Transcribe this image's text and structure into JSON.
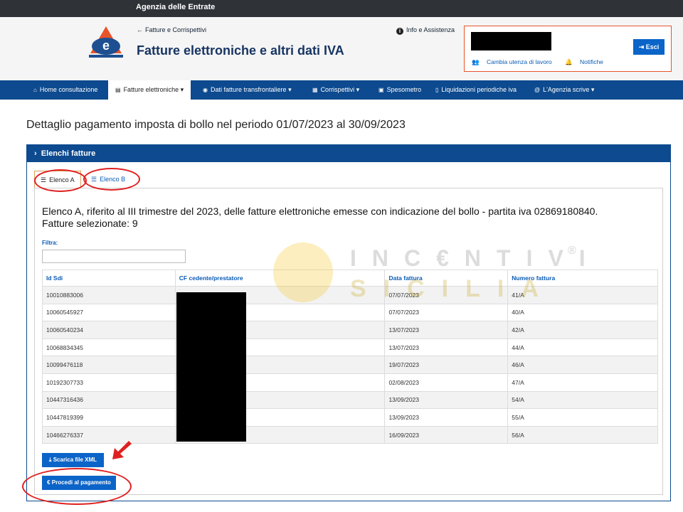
{
  "topbar": {
    "title": "Agenzia delle Entrate"
  },
  "header": {
    "back_link": "Fatture e Corrispettivi",
    "app_title": "Fatture elettroniche e altri dati IVA",
    "info_link": "Info e Assistenza",
    "info_icon": "i",
    "user": {
      "change_user": "Cambia utenza di lavoro",
      "notifications": "Notifiche",
      "logout": "Esci"
    }
  },
  "nav": {
    "items": [
      {
        "label": "Home consultazione",
        "icon": "home-icon",
        "glyph": "⌂"
      },
      {
        "label": "Fatture elettroniche",
        "icon": "document-icon",
        "glyph": "▤",
        "dropdown": "▾"
      },
      {
        "label": "Dati fatture transfrontaliere",
        "icon": "globe-icon",
        "glyph": "◉",
        "dropdown": "▾"
      },
      {
        "label": "Corrispettivi",
        "icon": "calculator-icon",
        "glyph": "▦",
        "dropdown": "▾"
      },
      {
        "label": "Spesometro",
        "icon": "bag-icon",
        "glyph": "▣"
      },
      {
        "label": "Liquidazioni periodiche iva",
        "icon": "file-icon",
        "glyph": "▯"
      },
      {
        "label": "L'Agenzia scrive",
        "icon": "at-icon",
        "glyph": "@",
        "dropdown": "▾"
      }
    ]
  },
  "page": {
    "title": "Dettaglio pagamento imposta di bollo nel periodo 01/07/2023 al 30/09/2023"
  },
  "panel": {
    "header": "Elenchi fatture",
    "header_icon": "›",
    "tabs": [
      {
        "label": "Elenco A",
        "glyph": "☰",
        "active": true
      },
      {
        "label": "Elenco B",
        "glyph": "☰",
        "active": false
      }
    ],
    "heading_line1": "Elenco A, riferito al III trimestre del 2023, delle fatture elettroniche emesse con indicazione del bollo - partita iva 02869180840.",
    "heading_line2": "Fatture selezionate: 9",
    "filter_label": "Filtra:",
    "filter_value": ""
  },
  "table": {
    "columns": [
      "Id Sdi",
      "CF cedente/prestatore",
      "Data fattura",
      "Numero fattura"
    ],
    "rows": [
      {
        "id_sdi": "10010883006",
        "cf": "",
        "data": "07/07/2023",
        "numero": "41/A"
      },
      {
        "id_sdi": "10060545927",
        "cf": "",
        "data": "07/07/2023",
        "numero": "40/A"
      },
      {
        "id_sdi": "10060540234",
        "cf": "",
        "data": "13/07/2023",
        "numero": "42/A"
      },
      {
        "id_sdi": "10068834345",
        "cf": "",
        "data": "13/07/2023",
        "numero": "44/A"
      },
      {
        "id_sdi": "10099476118",
        "cf": "",
        "data": "19/07/2023",
        "numero": "46/A"
      },
      {
        "id_sdi": "10192307733",
        "cf": "",
        "data": "02/08/2023",
        "numero": "47/A"
      },
      {
        "id_sdi": "10447316436",
        "cf": "",
        "data": "13/09/2023",
        "numero": "54/A"
      },
      {
        "id_sdi": "10447819399",
        "cf": "",
        "data": "13/09/2023",
        "numero": "55/A"
      },
      {
        "id_sdi": "10466276337",
        "cf": "",
        "data": "16/09/2023",
        "numero": "56/A"
      }
    ]
  },
  "buttons": {
    "download_xml": "Scarica file XML",
    "download_glyph": "⤓",
    "pay": "Procedi al pagamento",
    "pay_glyph": "€"
  },
  "watermark": {
    "line1": "INC€NTIVI",
    "line2": "SICILIA",
    "registered": "®"
  },
  "colors": {
    "nav": "#0d4a8f",
    "button": "#0b64c8",
    "accent_border": "#e8542a",
    "annotation_red": "#e02020"
  }
}
